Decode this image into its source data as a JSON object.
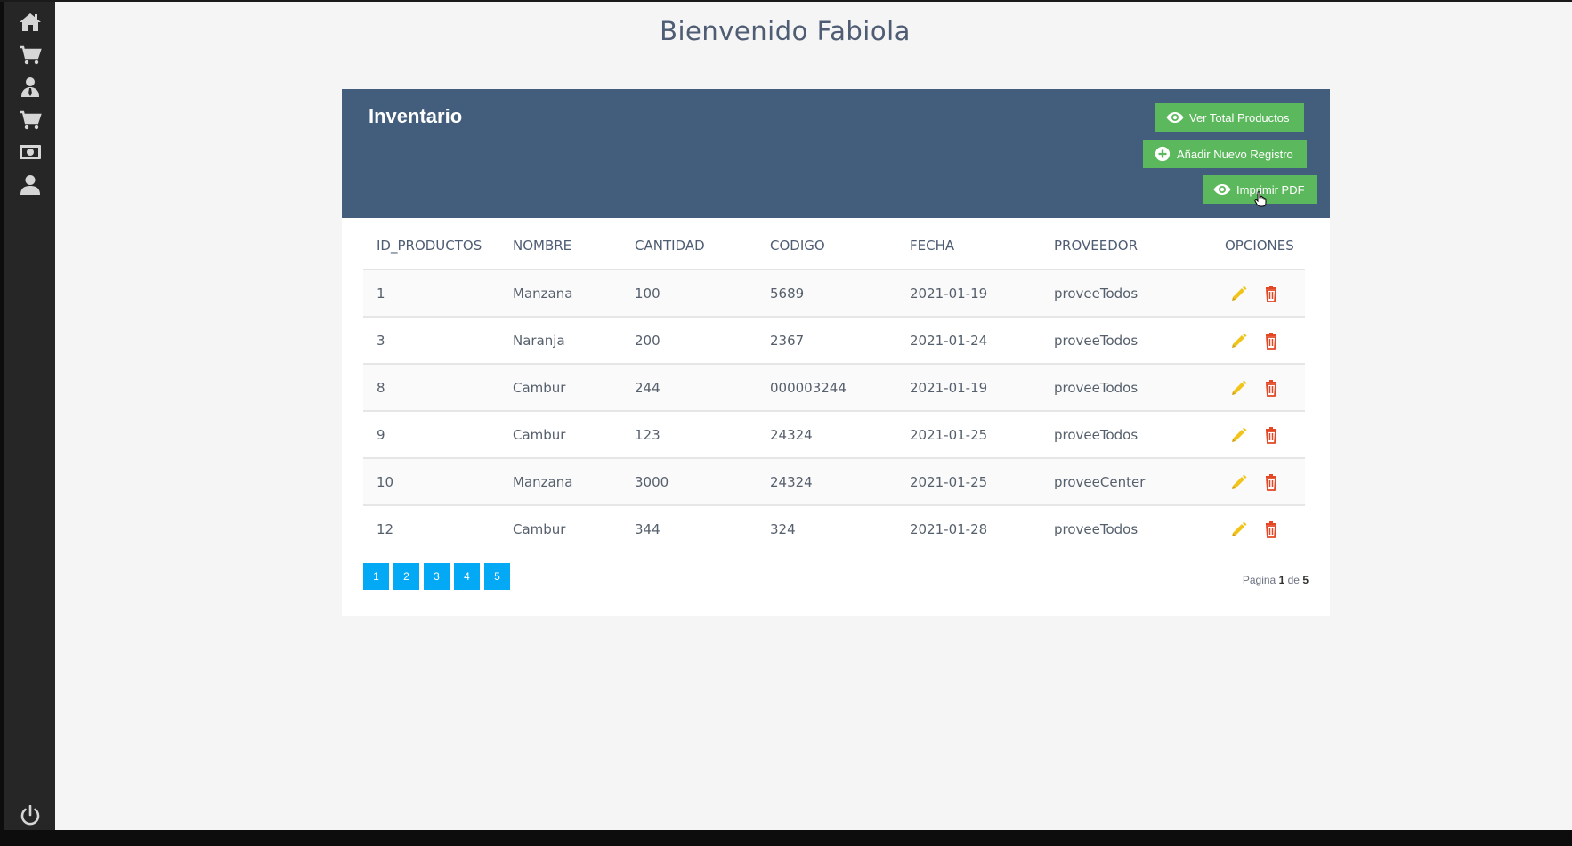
{
  "sidebar": {
    "icons": [
      "home-icon",
      "cart-icon",
      "user-tie-icon",
      "cart-icon",
      "money-icon",
      "user-icon"
    ],
    "logout_icon": "power-icon"
  },
  "header": {
    "welcome": "Bienvenido Fabiola"
  },
  "card": {
    "title": "Inventario",
    "buttons": {
      "ver_total": "Ver Total Productos",
      "anadir": "Añadir Nuevo Registro",
      "imprimir": "Imprimir PDF"
    }
  },
  "table": {
    "columns": [
      "ID_PRODUCTOS",
      "NOMBRE",
      "CANTIDAD",
      "CODIGO",
      "FECHA",
      "PROVEEDOR",
      "OPCIONES"
    ],
    "rows": [
      [
        "1",
        "Manzana",
        "100",
        "5689",
        "2021-01-19",
        "proveeTodos"
      ],
      [
        "3",
        "Naranja",
        "200",
        "2367",
        "2021-01-24",
        "proveeTodos"
      ],
      [
        "8",
        "Cambur",
        "244",
        "000003244",
        "2021-01-19",
        "proveeTodos"
      ],
      [
        "9",
        "Cambur",
        "123",
        "24324",
        "2021-01-25",
        "proveeTodos"
      ],
      [
        "10",
        "Manzana",
        "3000",
        "24324",
        "2021-01-25",
        "proveeCenter"
      ],
      [
        "12",
        "Cambur",
        "344",
        "324",
        "2021-01-28",
        "proveeTodos"
      ]
    ]
  },
  "pagination": {
    "pages": [
      "1",
      "2",
      "3",
      "4",
      "5"
    ],
    "info_prefix": "Pagina",
    "current": "1",
    "info_mid": "de",
    "total": "5"
  },
  "colors": {
    "header_bg": "#435d7d",
    "button_green": "#5cb85c",
    "page_blue": "#03a9f4",
    "edit_yellow": "#f0c419",
    "delete_red": "#e34724"
  }
}
